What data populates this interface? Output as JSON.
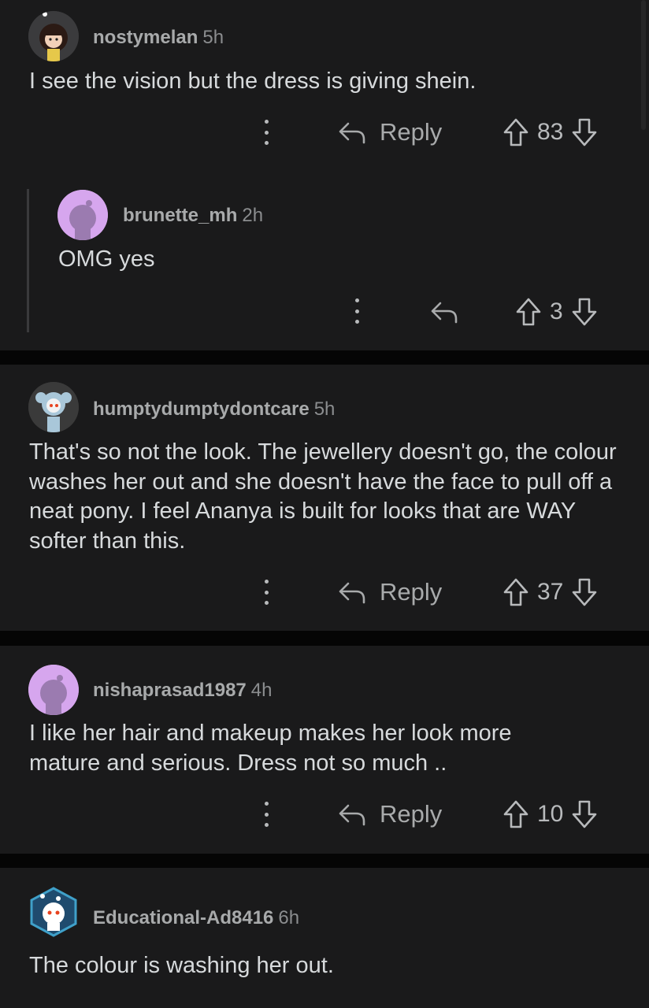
{
  "comments": [
    {
      "username": "nostymelan",
      "age": "5h",
      "text": "I see the vision but the dress is giving shein.",
      "reply_label": "Reply",
      "votes": "83"
    },
    {
      "username": "brunette_mh",
      "age": "2h",
      "text": "OMG yes",
      "reply_label": "",
      "votes": "3"
    },
    {
      "username": "humptydumptydontcare",
      "age": "5h",
      "text": "That's so not the look. The jewellery doesn't go, the colour washes her out and she doesn't have the face to pull off a neat pony. I feel Ananya is built for looks that are WAY softer than this.",
      "reply_label": "Reply",
      "votes": "37"
    },
    {
      "username": "nishaprasad1987",
      "age": "4h",
      "text": "I like her hair and makeup makes her look more mature and serious. Dress not so much ..",
      "reply_label": "Reply",
      "votes": "10"
    },
    {
      "username": "Educational-Ad8416",
      "age": "6h",
      "text": "The colour is washing her out."
    }
  ],
  "icons": {
    "more": "more-options-icon",
    "reply": "reply-arrow-icon",
    "upvote": "upvote-arrow-icon",
    "downvote": "downvote-arrow-icon"
  },
  "colors": {
    "background": "#050505",
    "card": "#1a1a1b",
    "text": "#d7dadc",
    "muted": "#a8aaab",
    "avatar_purple": "#d6a6ee"
  }
}
